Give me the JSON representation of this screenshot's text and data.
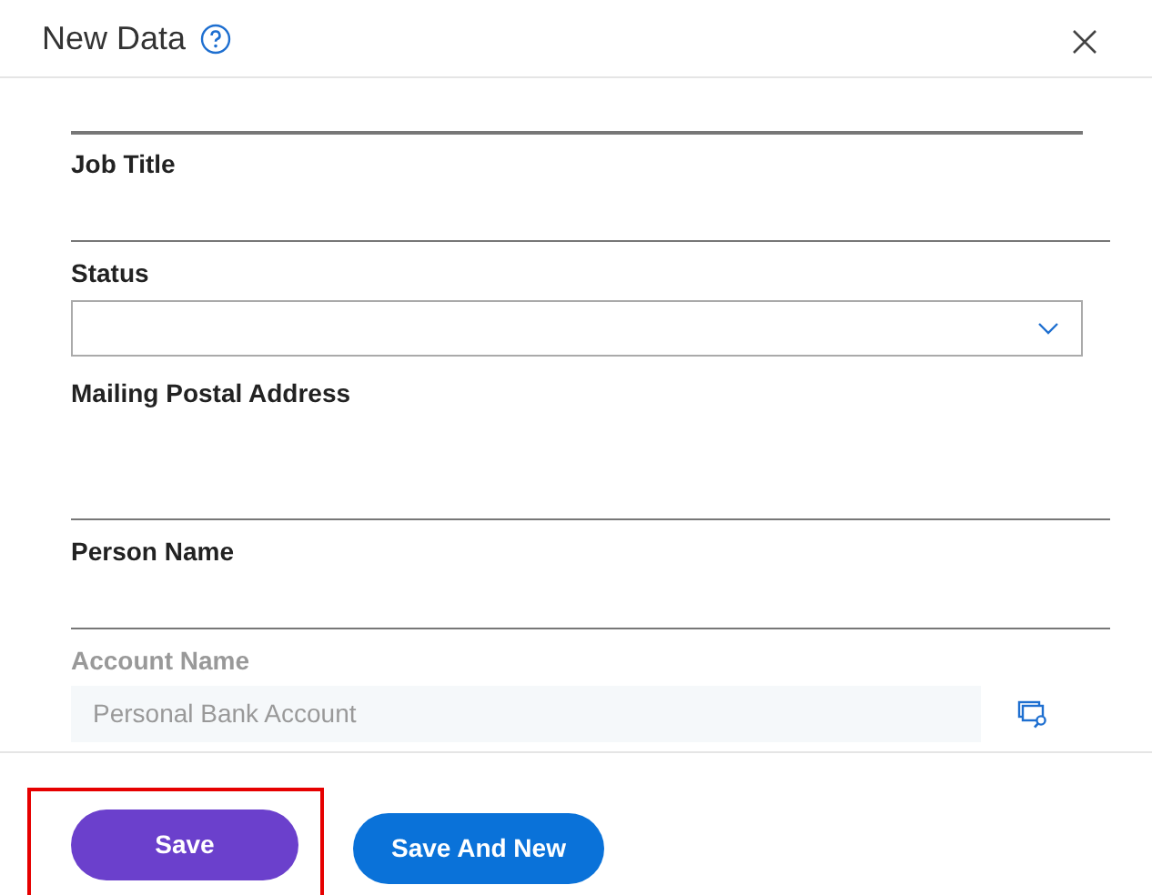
{
  "dialog": {
    "title": "New Data"
  },
  "fields": [
    {
      "kind": "text",
      "label": "Job Title",
      "disabled": false
    },
    {
      "kind": "select",
      "label": "Status",
      "disabled": false
    },
    {
      "kind": "textarea",
      "label": "Mailing Postal Address",
      "disabled": false
    },
    {
      "kind": "text",
      "label": "Person Name",
      "disabled": false
    },
    {
      "kind": "lookup",
      "label": "Account Name",
      "disabled": true,
      "value": "Personal Bank Account"
    }
  ],
  "buttons": [
    {
      "label": "Save",
      "kind": "primary",
      "highlighted": true
    },
    {
      "label": "Save And New",
      "kind": "secondary",
      "highlighted": false
    }
  ]
}
